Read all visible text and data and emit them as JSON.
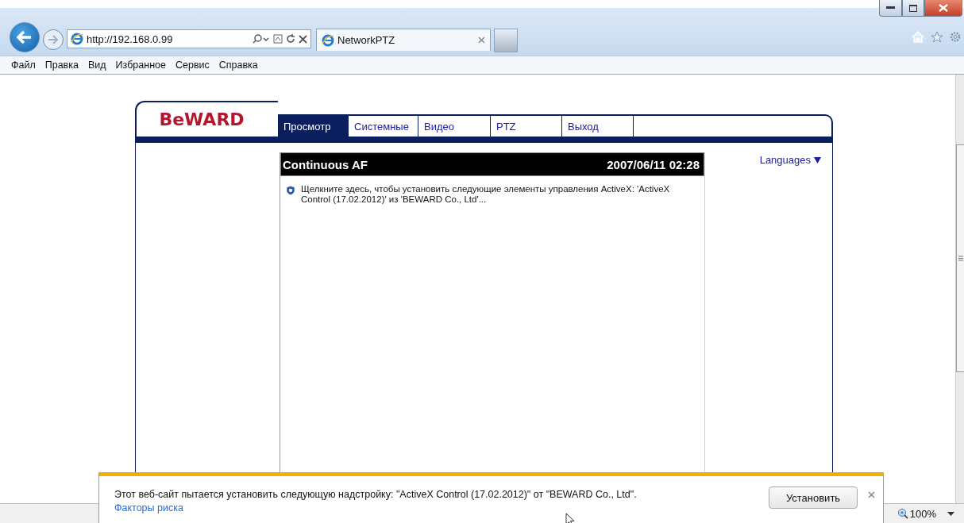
{
  "browser": {
    "address": "http://192.168.0.99",
    "tab": {
      "title": "NetworkPTZ"
    },
    "menu": [
      "Файл",
      "Правка",
      "Вид",
      "Избранное",
      "Сервис",
      "Справка"
    ]
  },
  "page": {
    "logo": "BeWARD",
    "tabs": [
      {
        "label": "Просмотр",
        "selected": true
      },
      {
        "label": "Системные",
        "selected": false
      },
      {
        "label": "Видео",
        "selected": false
      },
      {
        "label": "PTZ",
        "selected": false
      },
      {
        "label": "Выход",
        "selected": false
      }
    ],
    "panel": {
      "title": "Continuous AF",
      "datetime": "2007/06/11 02:28",
      "message": "Щелкните здесь, чтобы установить следующие элементы управления ActiveX: 'ActiveX Control (17.02.2012)' из 'BEWARD Co., Ltd'..."
    },
    "languages": "Languages"
  },
  "notification": {
    "text": "Этот веб-сайт пытается установить следующую надстройку: \"ActiveX Control (17.02.2012)\" от \"BEWARD Co., Ltd\".",
    "link": "Факторы риска",
    "button": "Установить"
  },
  "status_bar": {
    "zoom": "100%"
  }
}
